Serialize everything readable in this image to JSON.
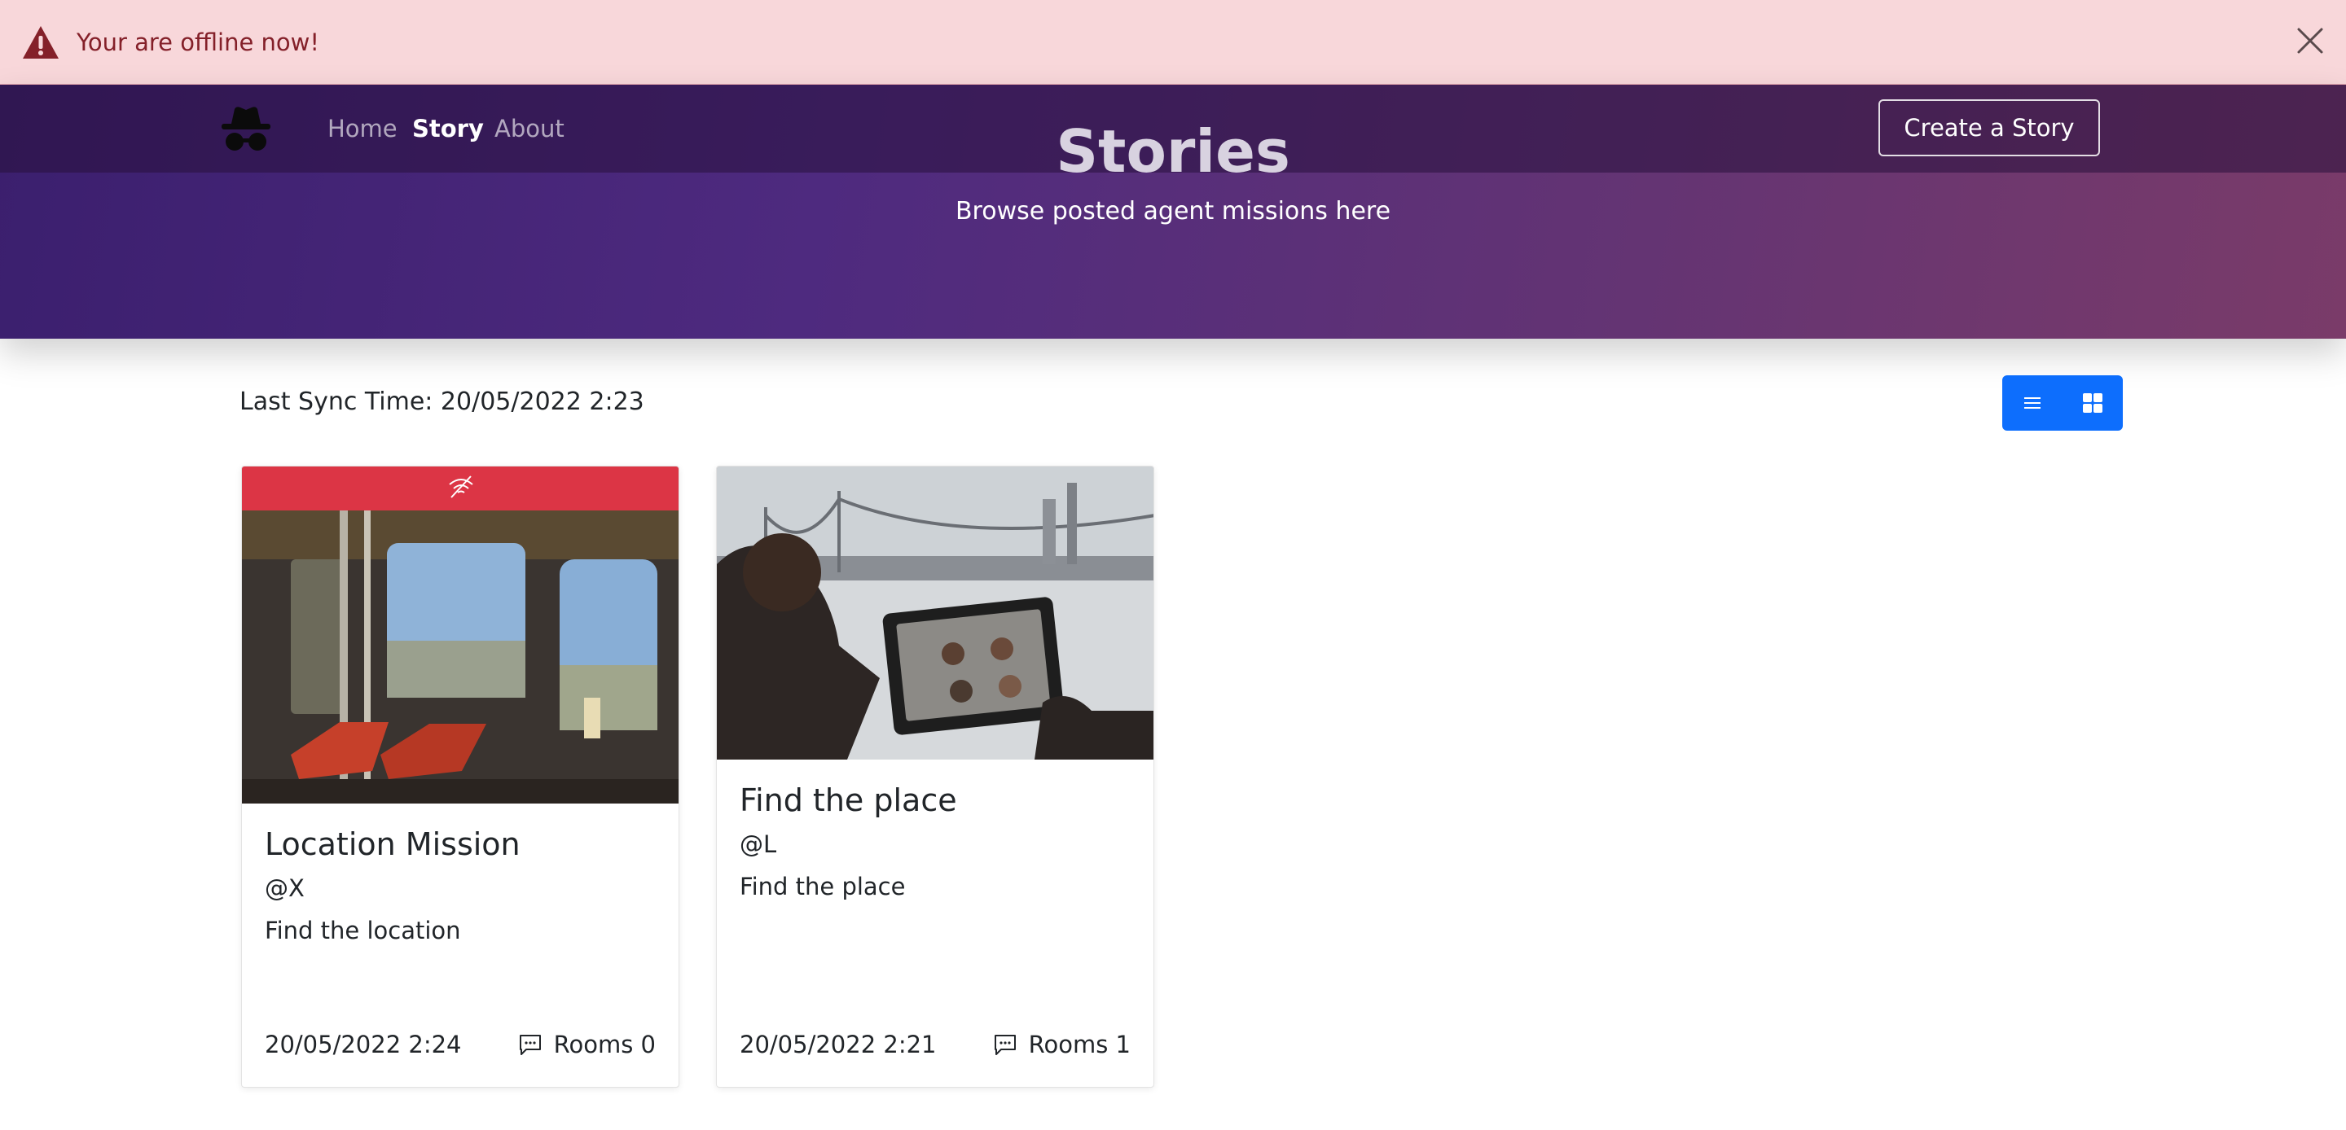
{
  "alert": {
    "message": "Your are offline now!",
    "icon": "warning-triangle-icon",
    "close_icon": "close-icon",
    "background": "#f8d7da",
    "text_color": "#842029"
  },
  "navbar": {
    "logo_icon": "incognito-agent-icon",
    "links": [
      {
        "label": "Home",
        "active": false
      },
      {
        "label": "Story",
        "active": true
      },
      {
        "label": "About",
        "active": false
      }
    ],
    "create_button": "Create a Story"
  },
  "hero": {
    "title": "Stories",
    "subtitle": "Browse posted agent missions here"
  },
  "sync": {
    "label": "Last Sync Time: 20/05/2022 2:23"
  },
  "view_toggle": {
    "list_icon": "list-view-icon",
    "grid_icon": "grid-view-icon",
    "accent": "#0d6efd"
  },
  "cards": [
    {
      "offline_badge_icon": "offline-signal-icon",
      "badge_color": "#dc3545",
      "image_desc_icon": "train-interior-photo",
      "title": "Location Mission",
      "author": "@X",
      "description": "Find the location",
      "date": "20/05/2022 2:24",
      "rooms": "Rooms 0",
      "rooms_icon": "chat-bubble-icon"
    },
    {
      "image_desc_icon": "tablet-video-call-photo",
      "title": "Find the place",
      "author": "@L",
      "description": "Find the place",
      "date": "20/05/2022 2:21",
      "rooms": "Rooms 1",
      "rooms_icon": "chat-bubble-icon"
    }
  ]
}
